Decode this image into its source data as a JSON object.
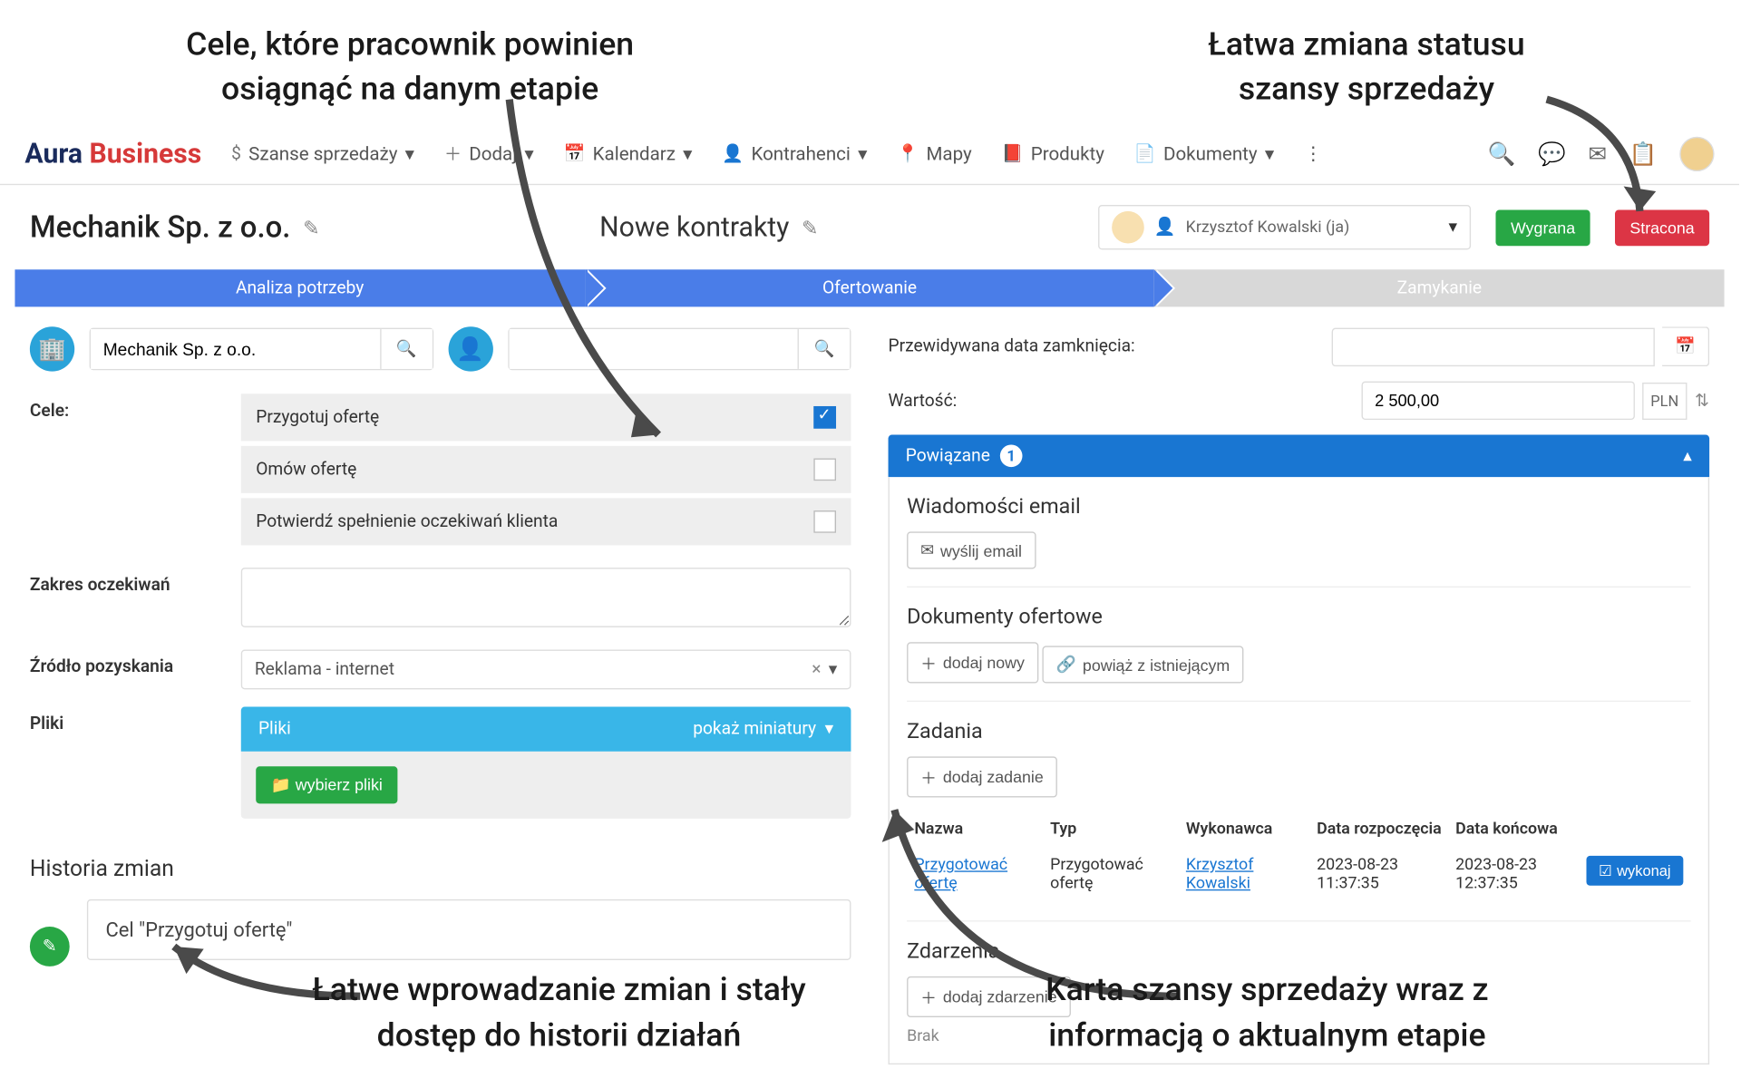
{
  "annotations": {
    "top_left": "Cele, które pracownik powinien osiągnąć na danym etapie",
    "top_right": "Łatwa zmiana statusu szansy sprzedaży",
    "bottom_left": "Łatwe wprowadzanie zmian i stały dostęp do historii działań",
    "bottom_right": "Karta szansy sprzedaży wraz z informacją o aktualnym etapie"
  },
  "logo": {
    "a": "Aura",
    "b": "Business"
  },
  "nav": {
    "sales": "Szanse sprzedaży",
    "add": "Dodaj",
    "calendar": "Kalendarz",
    "contractors": "Kontrahenci",
    "maps": "Mapy",
    "products": "Produkty",
    "documents": "Dokumenty"
  },
  "header": {
    "company": "Mechanik Sp. z o.o.",
    "contract": "Nowe kontrakty",
    "owner": "Krzysztof Kowalski (ja)",
    "won": "Wygrana",
    "lost": "Stracona"
  },
  "pipeline": [
    "Analiza potrzeby",
    "Ofertowanie",
    "Zamykanie"
  ],
  "left": {
    "company_search": "Mechanik Sp. z o.o.",
    "goals_label": "Cele:",
    "goals": [
      {
        "t": "Przygotuj ofertę",
        "c": true
      },
      {
        "t": "Omów ofertę",
        "c": false
      },
      {
        "t": "Potwierdź spełnienie oczekiwań klienta",
        "c": false
      }
    ],
    "expect_label": "Zakres oczekiwań",
    "source_label": "Źródło pozyskania",
    "source_value": "Reklama - internet",
    "files_label": "Pliki",
    "files_header": "Pliki",
    "files_thumbs": "pokaż miniatury",
    "choose_files": "wybierz pliki",
    "history_title": "Historia zmian",
    "history_item": "Cel \"Przygotuj ofertę\""
  },
  "right": {
    "close_date_label": "Przewidywana data zamknięcia:",
    "value_label": "Wartość:",
    "value_amount": "2 500,00",
    "currency": "PLN",
    "related_header": "Powiązane",
    "related_count": "1",
    "emails_title": "Wiadomości email",
    "send_email": "wyślij email",
    "docs_title": "Dokumenty ofertowe",
    "add_new": "dodaj nowy",
    "link_existing": "powiąż z istniejącym",
    "tasks_title": "Zadania",
    "add_task": "dodaj zadanie",
    "task_cols": [
      "Nazwa",
      "Typ",
      "Wykonawca",
      "Data rozpoczęcia",
      "Data końcowa",
      ""
    ],
    "task_row": {
      "name": "Przygotować ofertę",
      "type": "Przygotować ofertę",
      "who": "Krzysztof Kowalski",
      "start": "2023-08-23 11:37:35",
      "end": "2023-08-23 12:37:35",
      "execute": "wykonaj"
    },
    "events_title": "Zdarzenia",
    "add_event": "dodaj zdarzenie",
    "none": "Brak"
  }
}
